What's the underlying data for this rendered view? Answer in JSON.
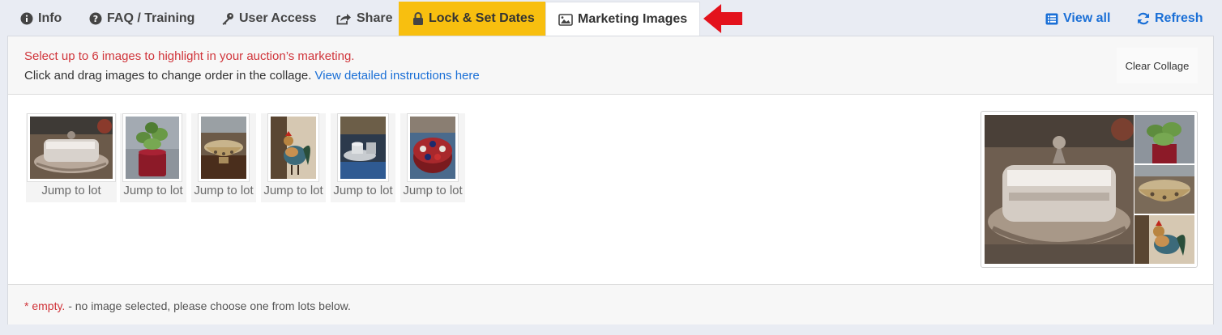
{
  "tabs": {
    "info": "Info",
    "faq": "FAQ / Training",
    "user_access": "User Access",
    "share": "Share",
    "lock": "Lock & Set Dates",
    "marketing": "Marketing Images"
  },
  "toolbar": {
    "view_all": "View all",
    "refresh": "Refresh"
  },
  "header": {
    "instruction_red": "Select up to 6 images to highlight in your auction’s marketing.",
    "instruction": "Click and drag images to change order in the collage.",
    "instructions_link": "View detailed instructions here",
    "clear_button": "Clear Collage"
  },
  "thumbnails": [
    {
      "subject": "silver butter dish",
      "link": "Jump to lot"
    },
    {
      "subject": "potted jade plant",
      "link": "Jump to lot"
    },
    {
      "subject": "pierced silver bowl",
      "link": "Jump to lot"
    },
    {
      "subject": "rooster figurine",
      "link": "Jump to lot"
    },
    {
      "subject": "glass dishes set",
      "link": "Jump to lot"
    },
    {
      "subject": "poker chip carousel",
      "link": "Jump to lot"
    }
  ],
  "collage": {
    "main": "silver butter dish",
    "side": [
      "potted jade plant",
      "pierced silver bowl",
      "rooster figurine"
    ]
  },
  "footer": {
    "empty_label": "* empty.",
    "empty_text": " - no image selected, please choose one from lots below."
  },
  "colors": {
    "accent": "#1a6fd6",
    "lock_tab": "#f8bf0f",
    "alert_red": "#d0343a",
    "arrow_red": "#e3121c"
  },
  "icons": [
    "info-circle-icon",
    "question-circle-icon",
    "key-icon",
    "share-icon",
    "lock-icon",
    "image-icon",
    "arrow-left-icon",
    "list-icon",
    "refresh-icon"
  ]
}
